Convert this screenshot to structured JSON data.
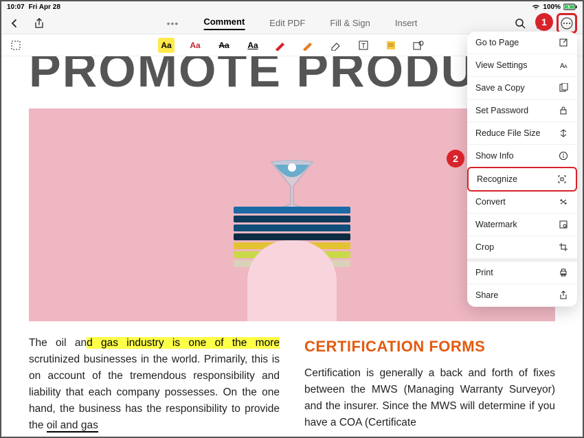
{
  "status": {
    "time": "10:07",
    "date": "Fri Apr 28",
    "battery": "100%"
  },
  "topbar": {
    "tabs": [
      "Comment",
      "Edit PDF",
      "Fill & Sign",
      "Insert"
    ],
    "active_tab": 0
  },
  "toolbar": {
    "tools": [
      {
        "name": "highlight-aa",
        "label": "Aa"
      },
      {
        "name": "red-aa",
        "label": "Aa"
      },
      {
        "name": "strike-aa",
        "label": "Aa"
      },
      {
        "name": "underline-aa",
        "label": "Aa"
      }
    ]
  },
  "document": {
    "title": "PROMOTE PRODUCTIV",
    "col1_html": "The oil an<mark class='y'>d gas industry is </mark><mark class='y'>one of the more</mark> scrutinized businesses in the world. Primarily, this is on account of the tremendous responsibility and liability that each company possesses. On the one hand, the business has the responsibility to provide the <span class='u'>oil and gas</span>",
    "col2_heading": "CERTIFICATION FORMS",
    "col2_text": "Certification is generally a back and forth of fixes between the MWS (Managing Warranty Surveyor) and the insurer. Since the MWS will determine if you have a COA (Certificate"
  },
  "menu": {
    "items": [
      {
        "label": "Go to Page",
        "icon": "goto"
      },
      {
        "label": "View Settings",
        "icon": "view"
      },
      {
        "label": "Save a Copy",
        "icon": "save"
      },
      {
        "label": "Set Password",
        "icon": "lock"
      },
      {
        "label": "Reduce File Size",
        "icon": "reduce"
      },
      {
        "label": "Show Info",
        "icon": "info"
      },
      {
        "label": "Recognize",
        "icon": "recognize",
        "highlight": true
      },
      {
        "label": "Convert",
        "icon": "convert"
      },
      {
        "label": "Watermark",
        "icon": "watermark"
      },
      {
        "label": "Crop",
        "icon": "crop"
      },
      {
        "label": "Print",
        "icon": "print",
        "divider": true
      },
      {
        "label": "Share",
        "icon": "share"
      }
    ]
  },
  "callouts": {
    "badge1": "1",
    "badge2": "2"
  },
  "colors": {
    "accent_red": "#d8232a",
    "hero_bg": "#efb7c2",
    "heading_orange": "#e35a0f"
  }
}
